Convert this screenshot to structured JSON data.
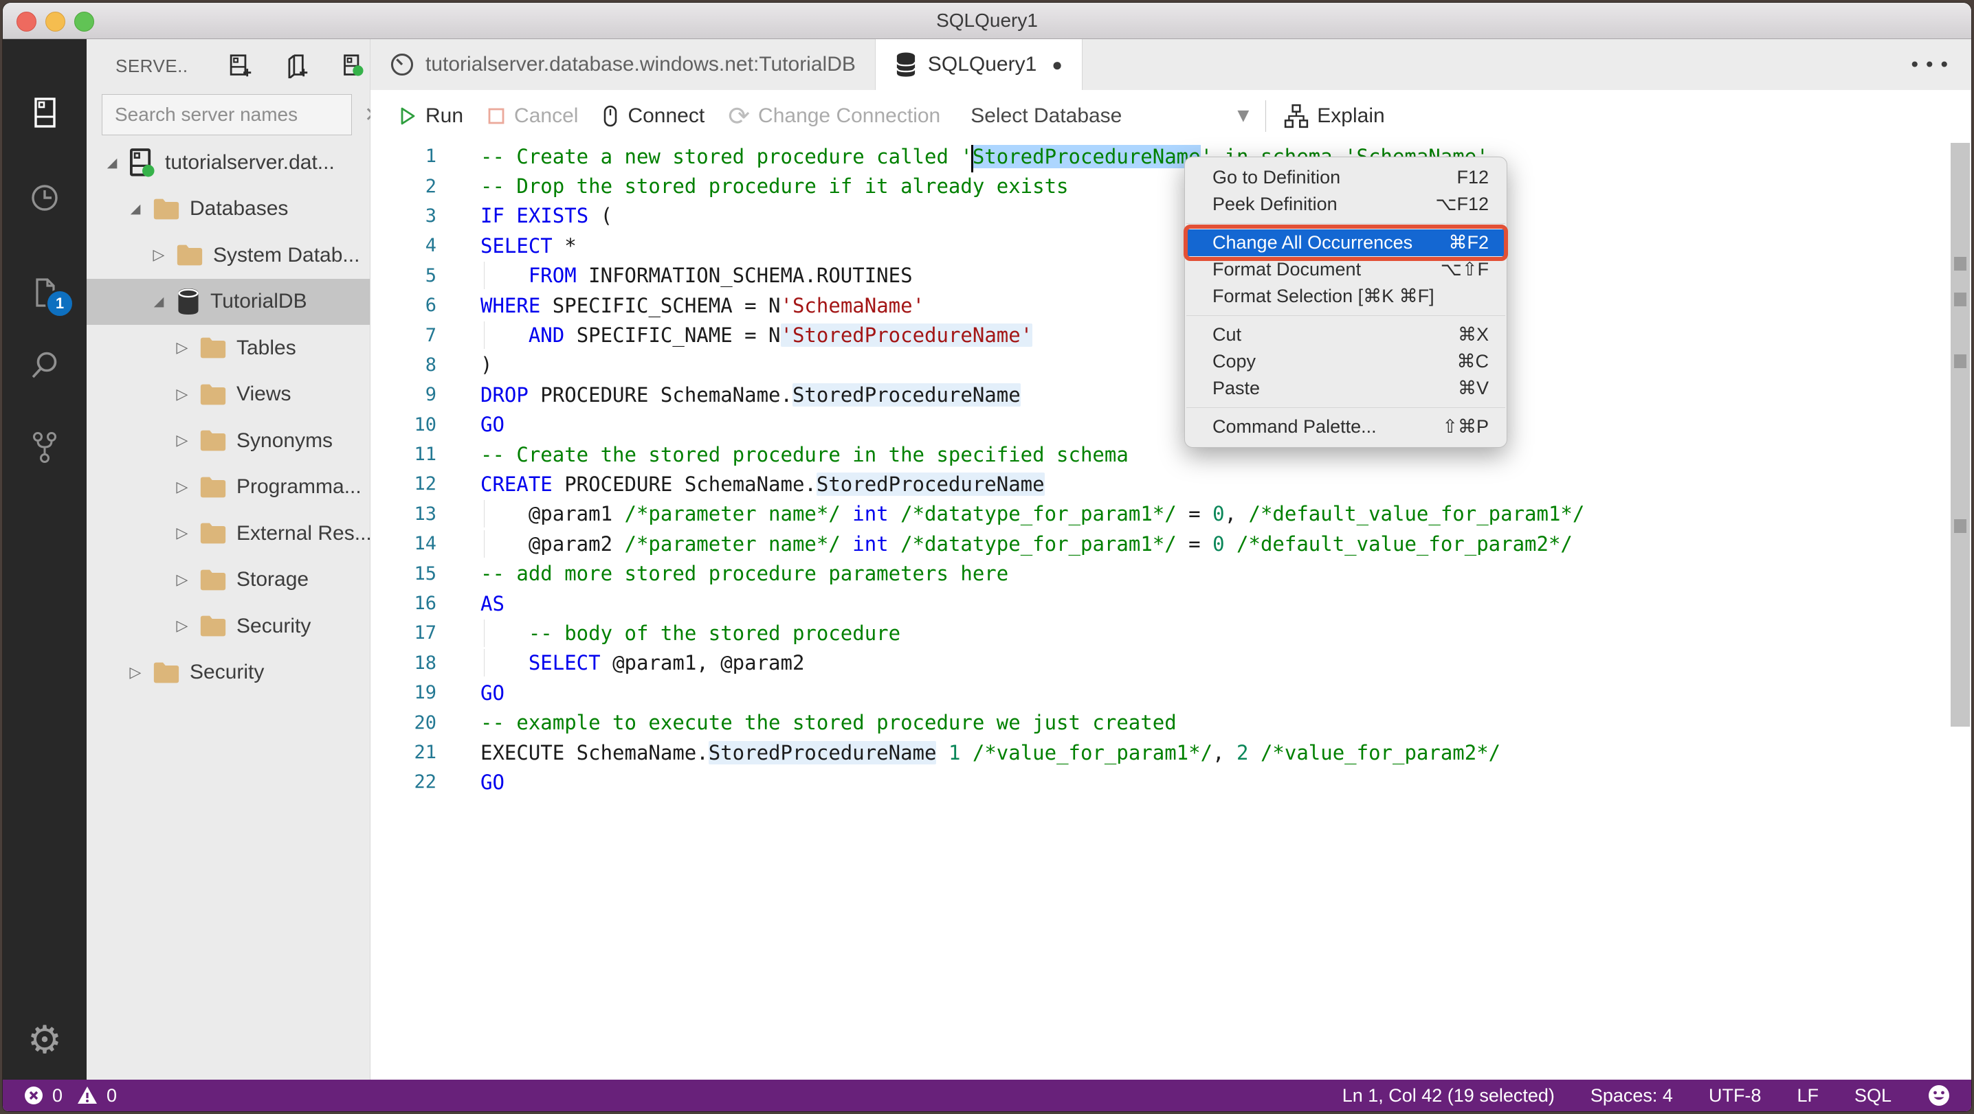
{
  "window": {
    "title": "SQLQuery1"
  },
  "activity_bar": {
    "items": [
      {
        "icon": "servers-icon",
        "active": true
      },
      {
        "icon": "task-history-icon"
      },
      {
        "icon": "open-editors-icon",
        "badge": "1"
      },
      {
        "icon": "search-icon"
      },
      {
        "icon": "source-control-icon"
      }
    ],
    "settings_icon": "settings-gear-icon"
  },
  "sidebar": {
    "header": {
      "title": "SERVE..",
      "actions": [
        "new-server-icon",
        "new-server-group-icon",
        "active-connections-icon"
      ]
    },
    "search": {
      "placeholder": "Search server names"
    },
    "tree": [
      {
        "label": "tutorialserver.dat...",
        "indent": 0,
        "expanded": true,
        "icon": "server"
      },
      {
        "label": "Databases",
        "indent": 1,
        "expanded": true,
        "icon": "folder"
      },
      {
        "label": "System Datab...",
        "indent": 2,
        "expanded": false,
        "icon": "folder"
      },
      {
        "label": "TutorialDB",
        "indent": 2,
        "expanded": true,
        "icon": "database",
        "selected": true
      },
      {
        "label": "Tables",
        "indent": 3,
        "expanded": false,
        "icon": "folder"
      },
      {
        "label": "Views",
        "indent": 3,
        "expanded": false,
        "icon": "folder"
      },
      {
        "label": "Synonyms",
        "indent": 3,
        "expanded": false,
        "icon": "folder"
      },
      {
        "label": "Programma...",
        "indent": 3,
        "expanded": false,
        "icon": "folder"
      },
      {
        "label": "External Res...",
        "indent": 3,
        "expanded": false,
        "icon": "folder"
      },
      {
        "label": "Storage",
        "indent": 3,
        "expanded": false,
        "icon": "folder"
      },
      {
        "label": "Security",
        "indent": 3,
        "expanded": false,
        "icon": "folder"
      },
      {
        "label": "Security",
        "indent": 1,
        "expanded": false,
        "icon": "folder"
      }
    ]
  },
  "tabs": [
    {
      "label": "tutorialserver.database.windows.net:TutorialDB",
      "icon": "dashboard-icon",
      "active": false,
      "dirty": false
    },
    {
      "label": "SQLQuery1",
      "icon": "database-file-icon",
      "active": true,
      "dirty": true
    }
  ],
  "tab_actions": {
    "more": "•••"
  },
  "toolbar": {
    "run": "Run",
    "cancel": "Cancel",
    "connect": "Connect",
    "change_connection": "Change Connection",
    "select_database": "Select Database",
    "explain": "Explain"
  },
  "editor": {
    "lines": [
      {
        "n": "1",
        "segs": [
          {
            "t": "-- Create a new stored procedure called '",
            "c": "cm"
          },
          {
            "t": "StoredProcedureName",
            "c": "cm",
            "sel": true,
            "caret": true
          },
          {
            "t": "' in schema 'SchemaName'",
            "c": "cm"
          }
        ]
      },
      {
        "n": "2",
        "segs": [
          {
            "t": "-- Drop the stored procedure if it already exists",
            "c": "cm"
          }
        ]
      },
      {
        "n": "3",
        "segs": [
          {
            "t": "IF",
            "c": "kw"
          },
          {
            "t": " ",
            "c": "id"
          },
          {
            "t": "EXISTS",
            "c": "kw"
          },
          {
            "t": " (",
            "c": "id"
          }
        ]
      },
      {
        "n": "4",
        "segs": [
          {
            "t": "SELECT",
            "c": "kw"
          },
          {
            "t": " *",
            "c": "id"
          }
        ]
      },
      {
        "n": "5",
        "guide": true,
        "segs": [
          {
            "t": "    ",
            "c": "id"
          },
          {
            "t": "FROM",
            "c": "kw"
          },
          {
            "t": " INFORMATION_SCHEMA.ROUTINES",
            "c": "id"
          }
        ]
      },
      {
        "n": "6",
        "segs": [
          {
            "t": "WHERE",
            "c": "kw"
          },
          {
            "t": " SPECIFIC_SCHEMA = N",
            "c": "id"
          },
          {
            "t": "'SchemaName'",
            "c": "str"
          }
        ]
      },
      {
        "n": "7",
        "guide": true,
        "segs": [
          {
            "t": "    ",
            "c": "id"
          },
          {
            "t": "AND",
            "c": "kw"
          },
          {
            "t": " SPECIFIC_NAME = N",
            "c": "id"
          },
          {
            "t": "'StoredProcedureName'",
            "c": "str",
            "occ": true
          }
        ]
      },
      {
        "n": "8",
        "segs": [
          {
            "t": ")",
            "c": "id"
          }
        ]
      },
      {
        "n": "9",
        "segs": [
          {
            "t": "DROP",
            "c": "kw"
          },
          {
            "t": " PROCEDURE SchemaName.",
            "c": "id"
          },
          {
            "t": "StoredProcedureName",
            "c": "id",
            "occ": true
          }
        ]
      },
      {
        "n": "10",
        "segs": [
          {
            "t": "GO",
            "c": "kw"
          }
        ]
      },
      {
        "n": "11",
        "segs": [
          {
            "t": "-- Create the stored procedure in the specified schema",
            "c": "cm"
          }
        ]
      },
      {
        "n": "12",
        "segs": [
          {
            "t": "CREATE",
            "c": "kw"
          },
          {
            "t": " PROCEDURE SchemaName.",
            "c": "id"
          },
          {
            "t": "StoredProcedureName",
            "c": "id",
            "occ": true
          }
        ]
      },
      {
        "n": "13",
        "guide": true,
        "segs": [
          {
            "t": "    @param1 ",
            "c": "id"
          },
          {
            "t": "/*parameter name*/",
            "c": "cm"
          },
          {
            "t": " ",
            "c": "id"
          },
          {
            "t": "int",
            "c": "kw"
          },
          {
            "t": " ",
            "c": "id"
          },
          {
            "t": "/*datatype_for_param1*/",
            "c": "cm"
          },
          {
            "t": " = ",
            "c": "id"
          },
          {
            "t": "0",
            "c": "num"
          },
          {
            "t": ", ",
            "c": "id"
          },
          {
            "t": "/*default_value_for_param1*/",
            "c": "cm"
          }
        ]
      },
      {
        "n": "14",
        "guide": true,
        "segs": [
          {
            "t": "    @param2 ",
            "c": "id"
          },
          {
            "t": "/*parameter name*/",
            "c": "cm"
          },
          {
            "t": " ",
            "c": "id"
          },
          {
            "t": "int",
            "c": "kw"
          },
          {
            "t": " ",
            "c": "id"
          },
          {
            "t": "/*datatype_for_param1*/",
            "c": "cm"
          },
          {
            "t": " = ",
            "c": "id"
          },
          {
            "t": "0",
            "c": "num"
          },
          {
            "t": " ",
            "c": "id"
          },
          {
            "t": "/*default_value_for_param2*/",
            "c": "cm"
          }
        ]
      },
      {
        "n": "15",
        "segs": [
          {
            "t": "-- add more stored procedure parameters here",
            "c": "cm"
          }
        ]
      },
      {
        "n": "16",
        "segs": [
          {
            "t": "AS",
            "c": "kw"
          }
        ]
      },
      {
        "n": "17",
        "guide": true,
        "segs": [
          {
            "t": "    ",
            "c": "id"
          },
          {
            "t": "-- body of the stored procedure",
            "c": "cm"
          }
        ]
      },
      {
        "n": "18",
        "guide": true,
        "segs": [
          {
            "t": "    ",
            "c": "id"
          },
          {
            "t": "SELECT",
            "c": "kw"
          },
          {
            "t": " @param1, @param2",
            "c": "id"
          }
        ]
      },
      {
        "n": "19",
        "segs": [
          {
            "t": "GO",
            "c": "kw"
          }
        ]
      },
      {
        "n": "20",
        "segs": [
          {
            "t": "-- example to execute the stored procedure we just created",
            "c": "cm"
          }
        ]
      },
      {
        "n": "21",
        "segs": [
          {
            "t": "EXECUTE SchemaName.",
            "c": "id"
          },
          {
            "t": "StoredProcedureName",
            "c": "id",
            "occ": true
          },
          {
            "t": " ",
            "c": "id"
          },
          {
            "t": "1",
            "c": "num"
          },
          {
            "t": " ",
            "c": "id"
          },
          {
            "t": "/*value_for_param1*/",
            "c": "cm"
          },
          {
            "t": ", ",
            "c": "id"
          },
          {
            "t": "2",
            "c": "num"
          },
          {
            "t": " ",
            "c": "id"
          },
          {
            "t": "/*value_for_param2*/",
            "c": "cm"
          }
        ]
      },
      {
        "n": "22",
        "segs": [
          {
            "t": "GO",
            "c": "kw"
          }
        ]
      }
    ]
  },
  "context_menu": {
    "groups": [
      [
        {
          "label": "Go to Definition",
          "shortcut": "F12"
        },
        {
          "label": "Peek Definition",
          "shortcut": "⌥F12"
        }
      ],
      [
        {
          "label": "Change All Occurrences",
          "shortcut": "⌘F2",
          "selected": true,
          "annotated": true
        },
        {
          "label": "Format Document",
          "shortcut": "⌥⇧F"
        },
        {
          "label": "Format Selection [⌘K ⌘F]",
          "shortcut": ""
        }
      ],
      [
        {
          "label": "Cut",
          "shortcut": "⌘X"
        },
        {
          "label": "Copy",
          "shortcut": "⌘C"
        },
        {
          "label": "Paste",
          "shortcut": "⌘V"
        }
      ],
      [
        {
          "label": "Command Palette...",
          "shortcut": "⇧⌘P"
        }
      ]
    ]
  },
  "status_bar": {
    "problems": {
      "errors": "0",
      "warnings": "0"
    },
    "right": [
      {
        "name": "cursor-position",
        "text": "Ln 1, Col 42 (19 selected)"
      },
      {
        "name": "indentation",
        "text": "Spaces: 4"
      },
      {
        "name": "encoding",
        "text": "UTF-8"
      },
      {
        "name": "eol",
        "text": "LF"
      },
      {
        "name": "language-mode",
        "text": "SQL"
      }
    ]
  },
  "colors": {
    "selection": "#ADD6FF",
    "occurrence": "#E3EFFA",
    "menu_selection": "#1467D2",
    "annotation_box": "#E25036",
    "status_bar": "#68217A",
    "badge": "#0E70C0",
    "folder": "#DCB67A",
    "connected_dot": "#36B24A"
  }
}
